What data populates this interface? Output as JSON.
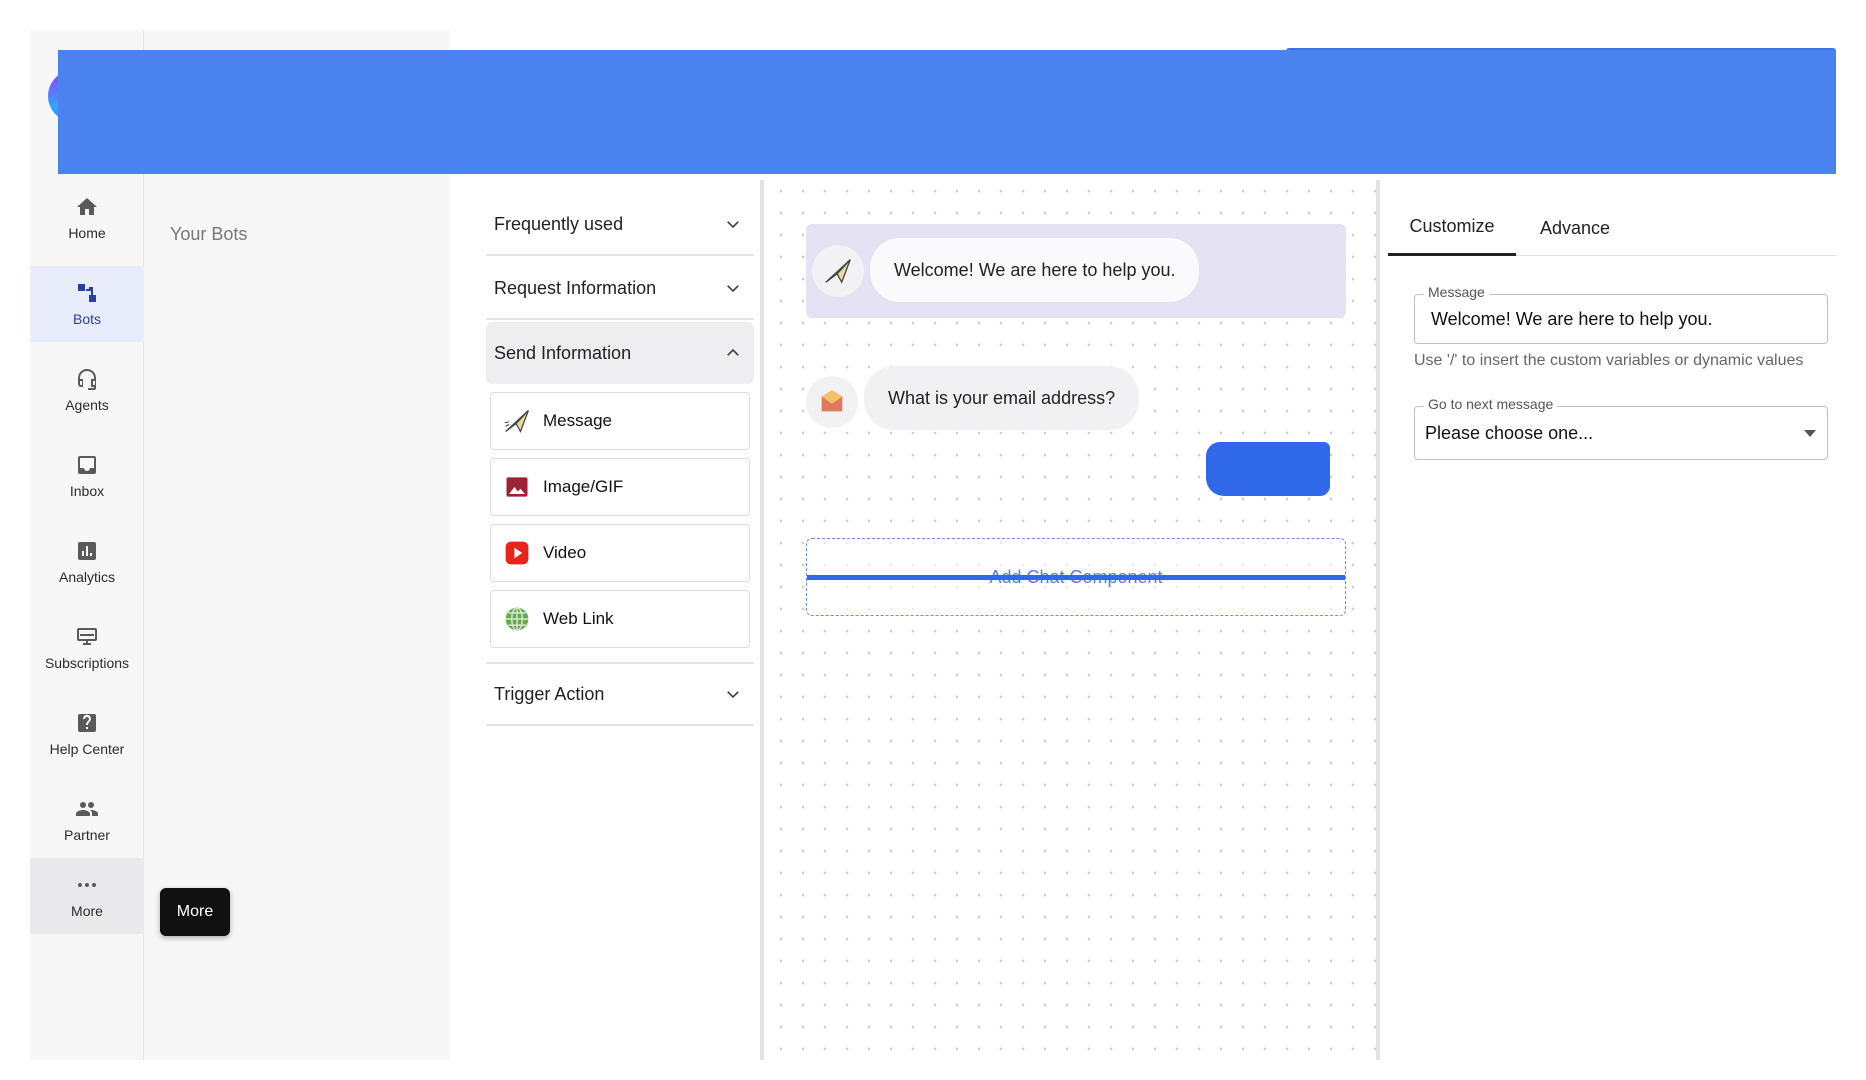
{
  "nav": {
    "items": [
      {
        "label": "Home",
        "icon": "home-icon"
      },
      {
        "label": "Bots",
        "icon": "bots-icon",
        "active": true
      },
      {
        "label": "Agents",
        "icon": "headset-icon"
      },
      {
        "label": "Inbox",
        "icon": "inbox-icon"
      },
      {
        "label": "Analytics",
        "icon": "analytics-icon"
      },
      {
        "label": "Subscriptions",
        "icon": "subscriptions-icon"
      },
      {
        "label": "Help Center",
        "icon": "help-icon"
      },
      {
        "label": "Partner",
        "icon": "people-icon"
      },
      {
        "label": "More",
        "icon": "more-icon",
        "hovered": true
      }
    ]
  },
  "bots_panel": {
    "title": "Your Bots"
  },
  "tooltip": {
    "text": "More"
  },
  "components": {
    "sections": [
      {
        "title": "Frequently used",
        "expanded": false
      },
      {
        "title": "Request Information",
        "expanded": false
      },
      {
        "title": "Send Information",
        "expanded": true
      },
      {
        "title": "Trigger Action",
        "expanded": false
      }
    ],
    "send_information_items": [
      {
        "label": "Message",
        "icon": "paper-plane-icon"
      },
      {
        "label": "Image/GIF",
        "icon": "image-icon"
      },
      {
        "label": "Video",
        "icon": "video-play-icon"
      },
      {
        "label": "Web Link",
        "icon": "globe-icon"
      }
    ]
  },
  "canvas": {
    "messages": [
      {
        "text": "Welcome! We are here to help you.",
        "icon": "paper-plane-icon",
        "selected": true
      },
      {
        "text": "What is your email address?",
        "icon": "envelope-icon"
      }
    ],
    "add_component_label": "Add Chat Component"
  },
  "properties": {
    "tabs": [
      "Customize",
      "Advance"
    ],
    "active_tab": "Customize",
    "message_label": "Message",
    "message_value": "Welcome! We are here to help you.",
    "helper_text": "Use '/' to insert the custom variables or dynamic values",
    "next_label": "Go to next message",
    "next_value": "Please choose one..."
  },
  "colors": {
    "accent": "#2b3ea5",
    "redaction": "#4a82f0",
    "selected_card": "#e4e2f3"
  }
}
